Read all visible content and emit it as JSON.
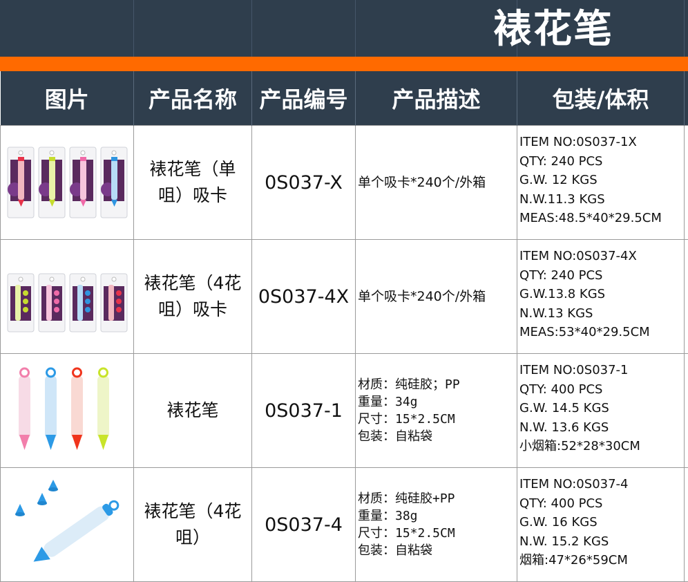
{
  "title": "裱花笔",
  "colors": {
    "header_bg": "#2f3e4d",
    "accent": "#ff6a00",
    "header_text": "#ffffff"
  },
  "table": {
    "headers": [
      "图片",
      "产品名称",
      "产品编号",
      "产品描述",
      "包装/体积"
    ],
    "rows": [
      {
        "image_icon": "blister-card-pens-single-tip-icon",
        "name_lines": [
          "裱花笔（单",
          "咀）吸卡"
        ],
        "code": "0S037-X",
        "description": [
          "单个吸卡*240个/外箱"
        ],
        "packing": [
          "ITEM NO:0S037-1X",
          "QTY: 240 PCS",
          "G.W. 12  KGS",
          "N.W.11.3 KGS",
          "MEAS:48.5*40*29.5CM"
        ]
      },
      {
        "image_icon": "blister-card-pens-four-tips-icon",
        "name_lines": [
          "裱花笔（4花",
          "咀）吸卡"
        ],
        "code": "0S037-4X",
        "description": [
          "单个吸卡*240个/外箱"
        ],
        "packing": [
          "ITEM NO:0S037-4X",
          "QTY: 240 PCS",
          "G.W.13.8 KGS",
          "N.W.13   KGS",
          "MEAS:53*40*29.5CM"
        ]
      },
      {
        "image_icon": "four-silicone-pens-icon",
        "name_lines": [
          "裱花笔"
        ],
        "code": "0S037-1",
        "description": [
          "材质：纯硅胶；PP",
          "重量：34g",
          "尺寸：15*2.5CM",
          "包装：自粘袋"
        ],
        "packing": [
          "ITEM NO:0S037-1",
          "QTY:  400 PCS",
          "G.W.  14.5 KGS",
          "N.W. 13.6  KGS",
          "小烟箱:52*28*30CM"
        ]
      },
      {
        "image_icon": "pen-with-three-tips-icon",
        "name_lines": [
          "裱花笔（4花",
          "咀）"
        ],
        "code": "0S037-4",
        "description": [
          "材质：纯硅胶+PP",
          "重量：38g",
          "尺寸：15*2.5CM",
          "包装：自粘袋"
        ],
        "packing": [
          "ITEM NO:0S037-4",
          "QTY:  400  PCS",
          "G.W.  16    KGS",
          "N.W. 15.2  KGS",
          "烟箱:47*26*59CM"
        ]
      }
    ]
  }
}
